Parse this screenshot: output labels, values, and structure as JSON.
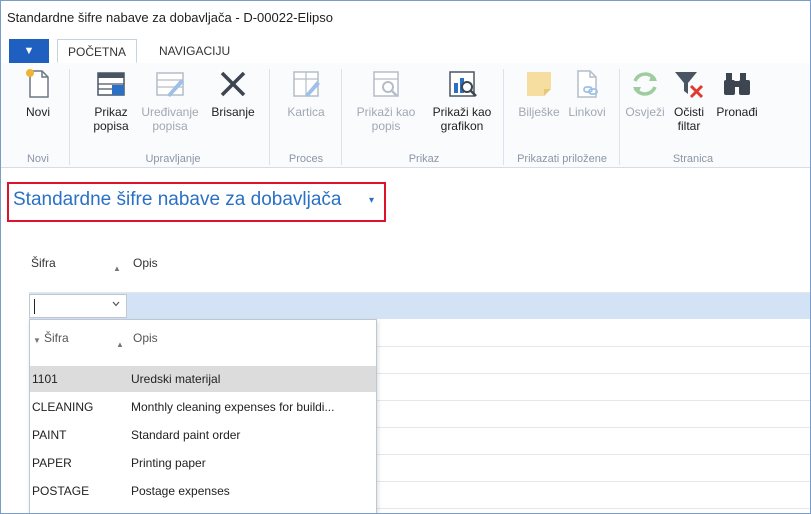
{
  "window": {
    "title": "Standardne šifre nabave za dobavljača - D-00022-Elipso"
  },
  "tabs": {
    "file_label": "▼",
    "items": [
      "POČETNA",
      "NAVIGACIJU"
    ]
  },
  "ribbon": {
    "groups": {
      "novi": "Novi",
      "upravljanje": "Upravljanje",
      "proces": "Proces",
      "prikaz": "Prikaz",
      "prilozene": "Prikazati priložene",
      "stranica": "Stranica"
    },
    "buttons": {
      "novi": "Novi",
      "prikaz_popisa_1": "Prikaz",
      "prikaz_popisa_2": "popisa",
      "uredivanje_1": "Uređivanje",
      "uredivanje_2": "popisa",
      "brisanje": "Brisanje",
      "kartica": "Kartica",
      "prikazi_popis_1": "Prikaži kao",
      "prikazi_popis_2": "popis",
      "prikazi_grafikon_1": "Prikaži kao",
      "prikazi_grafikon_2": "grafikon",
      "biljeske": "Bilješke",
      "linkovi": "Linkovi",
      "osvjezi": "Osvježi",
      "ocisti_1": "Očisti",
      "ocisti_2": "filtar",
      "pronadi": "Pronađi"
    }
  },
  "page": {
    "heading": "Standardne šifre nabave za dobavljača",
    "heading_caret": "▾"
  },
  "grid": {
    "columns": [
      "Šifra",
      "Opis"
    ]
  },
  "dropdown": {
    "columns": [
      "Šifra",
      "Opis"
    ],
    "rows": [
      {
        "code": "1101",
        "desc": "Uredski materijal"
      },
      {
        "code": "CLEANING",
        "desc": "Monthly cleaning expenses for buildi..."
      },
      {
        "code": "PAINT",
        "desc": "Standard paint order"
      },
      {
        "code": "PAPER",
        "desc": "Printing paper"
      },
      {
        "code": "POSTAGE",
        "desc": "Postage expenses"
      }
    ]
  },
  "colors": {
    "accent": "#2a71c6",
    "highlight_box": "#e0112b",
    "selected_row": "#d3e3f5",
    "file_tab": "#1f5fbf"
  }
}
